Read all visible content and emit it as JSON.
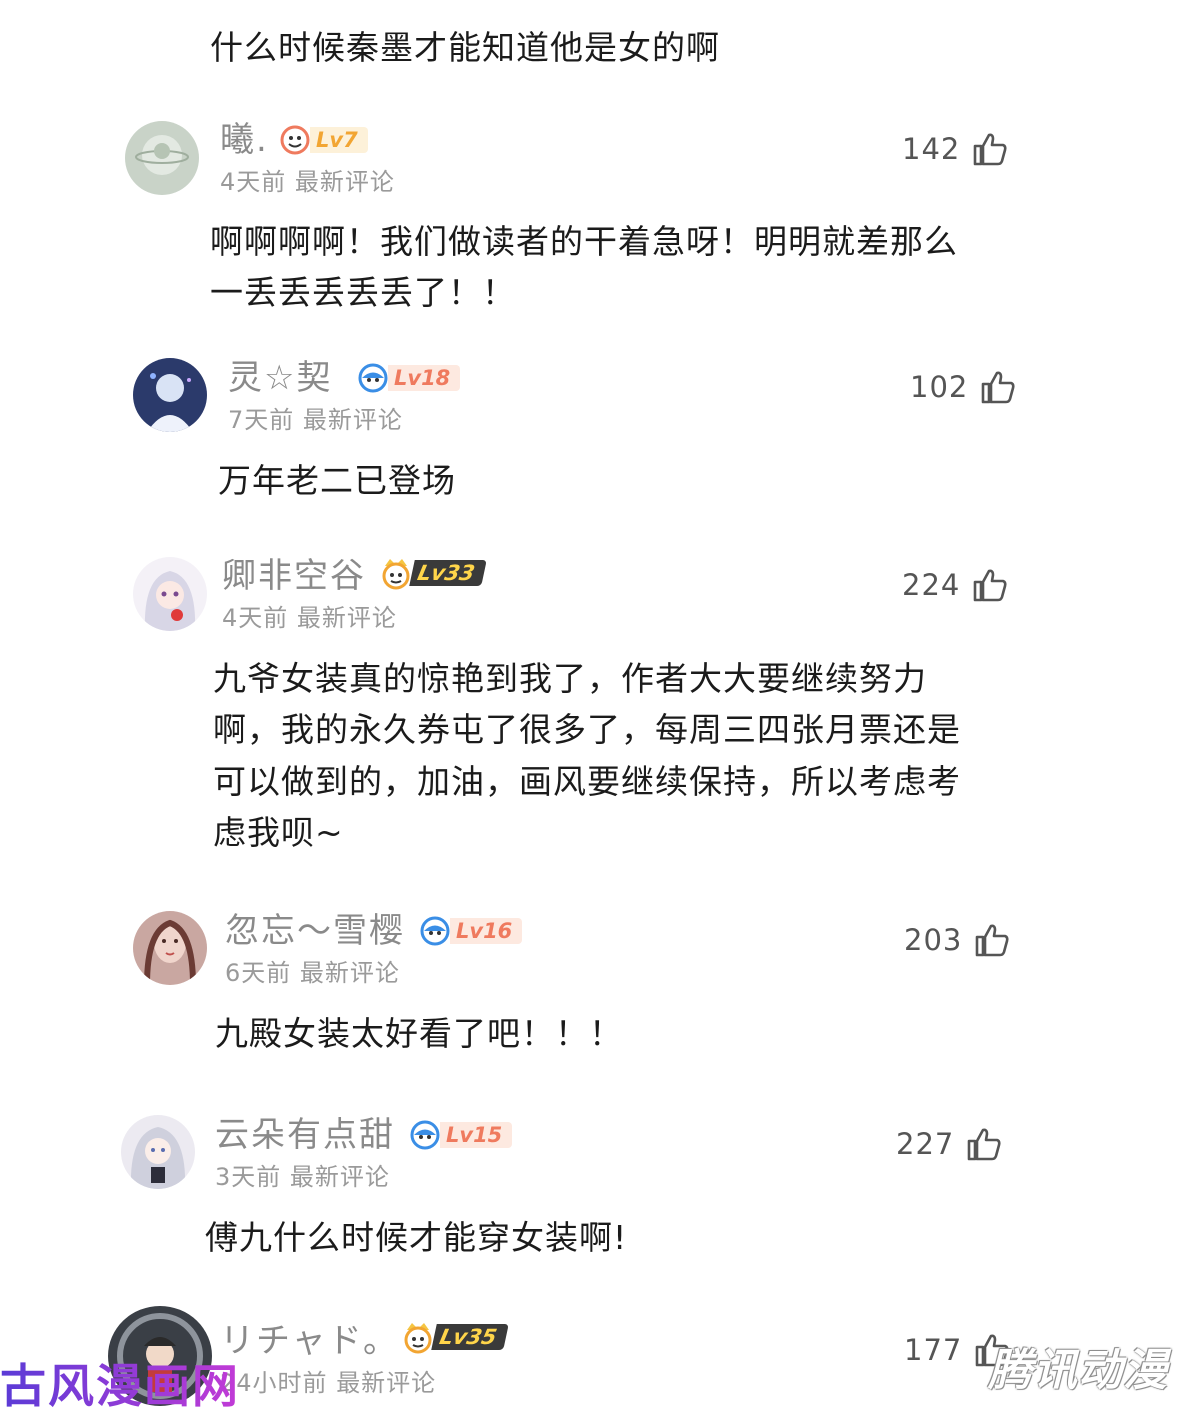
{
  "comments": [
    {
      "text": "什么时候秦墨才能知道他是女的啊"
    },
    {
      "username": "曦.",
      "level": "Lv7",
      "time": "4天前",
      "sort": "最新评论",
      "likes": "142",
      "text_lines": [
        "啊啊啊啊！我们做读者的干着急呀！明明就差那么",
        "一丢丢丢丢丢了！！"
      ]
    },
    {
      "username": "灵☆契",
      "level": "Lv18",
      "time": "7天前",
      "sort": "最新评论",
      "likes": "102",
      "text_lines": [
        "万年老二已登场"
      ]
    },
    {
      "username": "卿非空谷",
      "level": "Lv33",
      "time": "4天前",
      "sort": "最新评论",
      "likes": "224",
      "text_lines": [
        "九爷女装真的惊艳到我了，作者大大要继续努力",
        "啊，我的永久券屯了很多了，每周三四张月票还是",
        "可以做到的，加油，画风要继续保持，所以考虑考",
        "虑我呗~"
      ]
    },
    {
      "username": "忽忘～雪樱",
      "level": "Lv16",
      "time": "6天前",
      "sort": "最新评论",
      "likes": "203",
      "text_lines": [
        "九殿女装太好看了吧！！！"
      ]
    },
    {
      "username": "云朵有点甜",
      "level": "Lv15",
      "time": "3天前",
      "sort": "最新评论",
      "likes": "227",
      "text_lines": [
        "傅九什么时候才能穿女装啊!"
      ]
    },
    {
      "username": "リチャド。",
      "level": "Lv35",
      "time": "24小时前",
      "sort": "最新评论",
      "likes": "177"
    }
  ],
  "watermarks": {
    "left": "古风漫画网",
    "right": "腾讯动漫"
  },
  "icons": {
    "like": "thumbs-up-icon",
    "level_round": "smiley-badge-icon",
    "level_crown": "crown-badge-icon"
  },
  "colors": {
    "username": "#8a8a8a",
    "meta": "#9a9a9a",
    "level_orange": "#f2a532",
    "level_red": "#ef7a5e",
    "level_dark_bg": "#3a3a3a",
    "watermark_left": "#6b3bd6"
  }
}
